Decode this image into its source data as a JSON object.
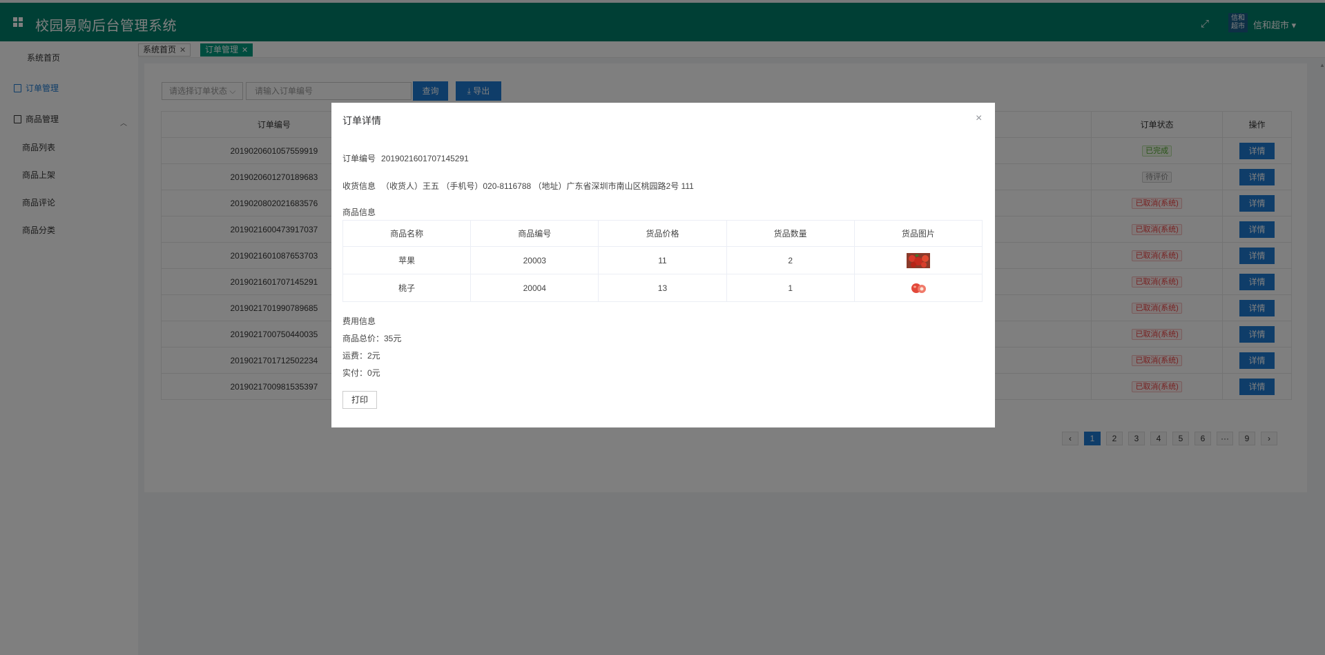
{
  "app": {
    "title": "校园易购后台管理系统",
    "store_logo_text": "信和\n超市",
    "store_name": "信和超市 ▾"
  },
  "sidebar": {
    "home": "系统首页",
    "order_mgmt": "订单管理",
    "goods_mgmt": "商品管理",
    "goods_list": "商品列表",
    "goods_add": "商品上架",
    "goods_comment": "商品评论",
    "goods_category": "商品分类"
  },
  "tabs": [
    {
      "label": "系统首页"
    },
    {
      "label": "订单管理"
    }
  ],
  "filters": {
    "status_placeholder": "请选择订单状态 ⌵",
    "order_no_placeholder": "请输入订单编号",
    "query_label": "查询",
    "export_label": "⤓ 导出"
  },
  "orders": {
    "headers": {
      "order_no": "订单编号",
      "status": "订单状态",
      "action": "操作"
    },
    "detail_label": "详情",
    "rows": [
      {
        "order_no": "2019020601057559919",
        "status": "已完成",
        "kind": "done"
      },
      {
        "order_no": "2019020601270189683",
        "status": "待评价",
        "kind": "pending"
      },
      {
        "order_no": "2019020802021683576",
        "status": "已取消(系统)",
        "kind": "cancel"
      },
      {
        "order_no": "2019021600473917037",
        "status": "已取消(系统)",
        "kind": "cancel"
      },
      {
        "order_no": "2019021601087653703",
        "status": "已取消(系统)",
        "kind": "cancel"
      },
      {
        "order_no": "2019021601707145291",
        "status": "已取消(系统)",
        "kind": "cancel"
      },
      {
        "order_no": "2019021701990789685",
        "status": "已取消(系统)",
        "kind": "cancel"
      },
      {
        "order_no": "2019021700750440035",
        "status": "已取消(系统)",
        "kind": "cancel"
      },
      {
        "order_no": "2019021701712502234",
        "status": "已取消(系统)",
        "kind": "cancel"
      },
      {
        "order_no": "2019021700981535397",
        "status": "已取消(系统)",
        "kind": "cancel"
      }
    ],
    "partial_cell": "6"
  },
  "pagination": {
    "prev": "‹",
    "pages": [
      "1",
      "2",
      "3",
      "4",
      "5",
      "6",
      "···",
      "9"
    ],
    "next": "›",
    "current": "1"
  },
  "modal": {
    "title": "订单详情",
    "close": "×",
    "order_no_label": "订单编号",
    "order_no": "2019021601707145291",
    "shipping_label": "收货信息",
    "shipping_text": "（收货人）王五 （手机号）020-8116788 （地址）广东省深圳市南山区桃园路2号 111",
    "goods_label": "商品信息",
    "goods_headers": [
      "商品名称",
      "商品编号",
      "货品价格",
      "货品数量",
      "货品图片"
    ],
    "goods_rows": [
      {
        "name": "苹果",
        "code": "20003",
        "price": "11",
        "qty": "2"
      },
      {
        "name": "桃子",
        "code": "20004",
        "price": "13",
        "qty": "1"
      }
    ],
    "fee_label": "费用信息",
    "total": "商品总价：35元",
    "shipping_fee": "运费：2元",
    "paid": "实付：0元",
    "print_label": "打印"
  }
}
